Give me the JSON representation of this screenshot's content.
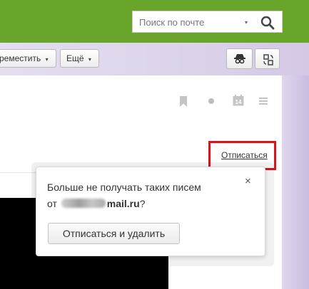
{
  "header": {
    "search_placeholder": "Поиск по почте",
    "search_dropdown_icon": "caret-down-icon",
    "search_icon": "search-icon",
    "brand_color": "#6aa52b"
  },
  "toolbar": {
    "move_label": "реместить",
    "more_label": "Ещё",
    "caret": "▾",
    "icon_buttons": [
      "spy-icon",
      "translate-icon"
    ]
  },
  "letter_actions": {
    "icons": [
      "bookmark-icon",
      "dot-icon",
      "calendar-icon",
      "menu-icon"
    ],
    "calendar_day": "14",
    "unsubscribe_link": "Отписаться",
    "highlight_color": "#d9141b"
  },
  "popup": {
    "line1": "Больше не получать таких писем",
    "line2_prefix": "от",
    "line2_domain": "mail.ru",
    "line2_suffix": "?",
    "close": "×",
    "button_label": "Отписаться и удалить"
  }
}
